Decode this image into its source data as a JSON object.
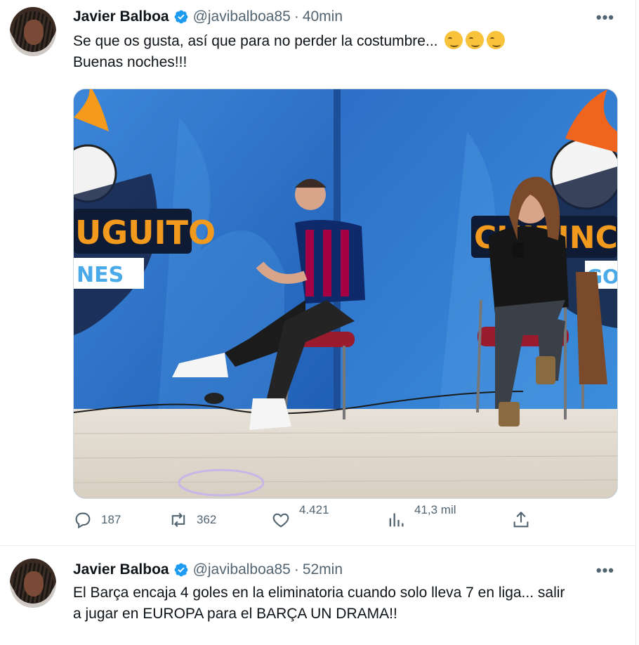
{
  "tweets": [
    {
      "name": "Javier Balboa",
      "handle": "@javibalboa85",
      "separator": "·",
      "time": "40min",
      "text_line1": "Se que os gusta, así que para no perder la costumbre...",
      "text_line2": "Buenas noches!!!",
      "emojis": [
        "smirk-emoji",
        "smirk-emoji",
        "smirk-emoji"
      ],
      "media": {
        "left_logo_text": "UGUITO",
        "left_banner_text": "NES",
        "right_logo_text": "CHIRINC",
        "right_banner_text": "GO"
      },
      "stats": {
        "replies": "187",
        "retweets": "362",
        "likes": "4.421",
        "views": "41,3 mil"
      }
    },
    {
      "name": "Javier Balboa",
      "handle": "@javibalboa85",
      "separator": "·",
      "time": "52min",
      "text_line1": "El Barça encaja 4 goles en la eliminatoria cuando solo lleva 7 en liga... salir",
      "text_line2": "a jugar en EUROPA para el BARÇA UN DRAMA!!"
    }
  ],
  "icons": {
    "more": "more-horizontal-icon",
    "verified": "verified-badge-icon",
    "reply": "reply-icon",
    "retweet": "retweet-icon",
    "like": "heart-icon",
    "views": "views-icon",
    "share": "share-icon"
  },
  "colors": {
    "verified": "#1d9bf0",
    "secondary_text": "#536471",
    "primary_text": "#0f1419"
  }
}
